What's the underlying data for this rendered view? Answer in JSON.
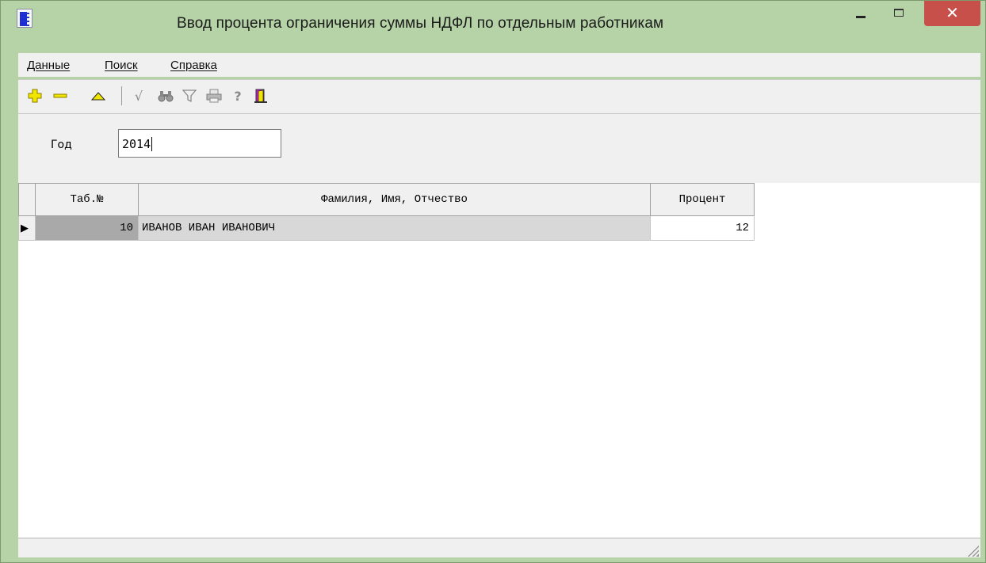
{
  "window": {
    "title": "Ввод процента ограничения суммы НДФЛ по отдельным работникам",
    "close_glyph": "✕"
  },
  "menu": [
    {
      "label": "Данные"
    },
    {
      "label": "Поиск"
    },
    {
      "label": "Справка"
    }
  ],
  "toolbar": {
    "icons": [
      "add-icon",
      "delete-icon",
      "edit-icon",
      "checkmark-icon",
      "binoculars-icon",
      "filter-icon",
      "printer-icon",
      "help-icon",
      "exit-door-icon"
    ],
    "glyphs": {
      "check": "√",
      "help": "?"
    }
  },
  "filter": {
    "year_label": "Год",
    "year_value": "2014"
  },
  "grid": {
    "columns": [
      "Таб.№",
      "Фамилия, Имя, Отчество",
      "Процент"
    ],
    "rows": [
      {
        "tab": "10",
        "name": "ИВАНОВ ИВАН ИВАНОВИЧ",
        "percent": "12"
      }
    ],
    "row_indicator": "▶"
  },
  "colors": {
    "window_frame": "#b5d3a6",
    "close_button": "#c7504a",
    "accent_yellow": "#f2e600"
  }
}
